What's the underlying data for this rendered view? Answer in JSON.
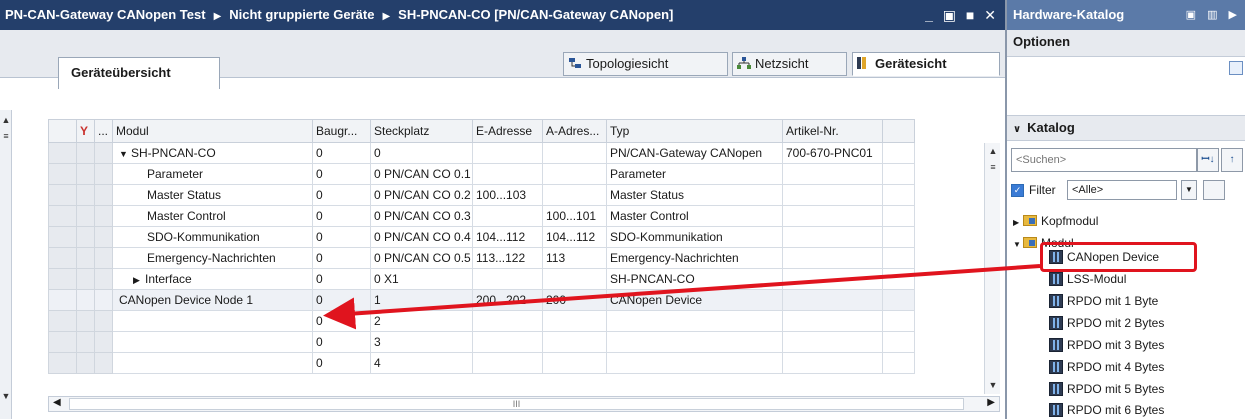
{
  "editor": {
    "title_parts": [
      "PN-CAN-Gateway CANopen Test",
      "Nicht gruppierte Geräte",
      "SH-PNCAN-CO [PN/CAN-Gateway CANopen]"
    ],
    "window_controls": "_ ▣ ■ ✕",
    "views": {
      "topology": "Topologiesicht",
      "network": "Netzsicht",
      "device": "Gerätesicht"
    },
    "tab_overview": "Geräteübersicht",
    "columns": [
      "",
      "",
      "...",
      "Modul",
      "Baugr...",
      "Steckplatz",
      "E-Adresse",
      "A-Adres...",
      "Typ",
      "Artikel-Nr.",
      ""
    ],
    "rows": [
      {
        "tog": "▼",
        "indent": 0,
        "modul": "SH-PNCAN-CO",
        "baugr": "0",
        "steck": "0",
        "e": "",
        "a": "",
        "typ": "PN/CAN-Gateway CANopen",
        "art": "700-670-PNC01"
      },
      {
        "tog": "",
        "indent": 2,
        "modul": "Parameter",
        "baugr": "0",
        "steck": "0 PN/CAN CO 0.1",
        "e": "",
        "a": "",
        "typ": "Parameter",
        "art": ""
      },
      {
        "tog": "",
        "indent": 2,
        "modul": "Master Status",
        "baugr": "0",
        "steck": "0 PN/CAN CO 0.2",
        "e": "100...103",
        "a": "",
        "typ": "Master Status",
        "art": ""
      },
      {
        "tog": "",
        "indent": 2,
        "modul": "Master Control",
        "baugr": "0",
        "steck": "0 PN/CAN CO 0.3",
        "e": "",
        "a": "100...101",
        "typ": "Master Control",
        "art": ""
      },
      {
        "tog": "",
        "indent": 2,
        "modul": "SDO-Kommunikation",
        "baugr": "0",
        "steck": "0 PN/CAN CO 0.4",
        "e": "104...112",
        "a": "104...112",
        "typ": "SDO-Kommunikation",
        "art": ""
      },
      {
        "tog": "",
        "indent": 2,
        "modul": "Emergency-Nachrichten",
        "baugr": "0",
        "steck": "0 PN/CAN CO 0.5",
        "e": "113...122",
        "a": "113",
        "typ": "Emergency-Nachrichten",
        "art": ""
      },
      {
        "tog": "▶",
        "indent": 1,
        "modul": "Interface",
        "baugr": "0",
        "steck": "0 X1",
        "e": "",
        "a": "",
        "typ": "SH-PNCAN-CO",
        "art": ""
      },
      {
        "tog": "",
        "indent": 0,
        "modul": "CANopen Device Node 1",
        "baugr": "0",
        "steck": "1",
        "e": "200...202",
        "a": "200",
        "typ": "CANopen Device",
        "art": "",
        "selected": true
      },
      {
        "tog": "",
        "indent": 0,
        "modul": "",
        "baugr": "0",
        "steck": "2",
        "e": "",
        "a": "",
        "typ": "",
        "art": ""
      },
      {
        "tog": "",
        "indent": 0,
        "modul": "",
        "baugr": "0",
        "steck": "3",
        "e": "",
        "a": "",
        "typ": "",
        "art": ""
      },
      {
        "tog": "",
        "indent": 0,
        "modul": "",
        "baugr": "0",
        "steck": "4",
        "e": "",
        "a": "",
        "typ": "",
        "art": ""
      }
    ],
    "hscroll_grip": "III"
  },
  "catalog": {
    "title": "Hardware-Katalog",
    "options_label": "Optionen",
    "katalog_label": "Katalog",
    "search_placeholder": "<Suchen>",
    "filter_label": "Filter",
    "filter_value": "<Alle>",
    "items": [
      {
        "label": "Kopfmodul",
        "tog": "▶",
        "type": "folder"
      },
      {
        "label": "Modul",
        "tog": "▼",
        "type": "folder"
      },
      {
        "label": "CANopen Device",
        "tog": "",
        "type": "device"
      },
      {
        "label": "LSS-Modul",
        "tog": "",
        "type": "device"
      },
      {
        "label": "RPDO mit 1 Byte",
        "tog": "",
        "type": "device"
      },
      {
        "label": "RPDO mit 2 Bytes",
        "tog": "",
        "type": "device"
      },
      {
        "label": "RPDO mit 3 Bytes",
        "tog": "",
        "type": "device"
      },
      {
        "label": "RPDO mit 4 Bytes",
        "tog": "",
        "type": "device"
      },
      {
        "label": "RPDO mit 5 Bytes",
        "tog": "",
        "type": "device"
      },
      {
        "label": "RPDO mit 6 Bytes",
        "tog": "",
        "type": "device"
      }
    ]
  },
  "colors": {
    "title_bar": "#243f6b",
    "catalog_title": "#5b7aa8",
    "annotation": "#e0141e"
  }
}
